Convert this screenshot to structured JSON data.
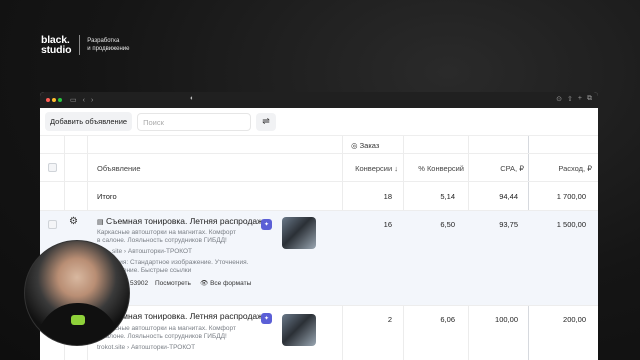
{
  "brand": {
    "logo_line1": "black.",
    "logo_line2": "studio",
    "tagline_line1": "Разработка",
    "tagline_line2": "и продвижение"
  },
  "browser": {
    "center_glyph": "◐",
    "icons": [
      "sidebar-icon",
      "back-icon",
      "forward-icon",
      "download-icon",
      "share-icon",
      "new-tab-icon",
      "tabs-icon"
    ]
  },
  "toolbar": {
    "add_label": "Добавить объявление",
    "search_placeholder": "Поиск",
    "filter_icon": "sliders-icon"
  },
  "table": {
    "goal_header": "◎ Заказ",
    "columns": {
      "ad": "Объявление",
      "conversions": "Конверсии ↓",
      "conv_pct": "% Конверсий",
      "cpa": "CPA, ₽",
      "spend": "Расход, ₽"
    },
    "total": {
      "label": "Итого",
      "conversions": "18",
      "conv_pct": "5,14",
      "cpa": "94,44",
      "spend": "1 700,00"
    },
    "rows": [
      {
        "title": "Съемная тонировка. Летняя распродажа",
        "text1": "Каркасные автошторки на магнитах. Комфорт",
        "text2": "в салоне. Лояльность сотрудников ГИБДД!",
        "site": "site › Автошторки-ТРОКОТ",
        "ext1": "ения: Стандартное изображение. Уточнения.",
        "ext2": "олнение. Быстрые ссылки",
        "id": "53902",
        "view": "Посмотреть",
        "formats": "Все форматы",
        "conversions": "16",
        "conv_pct": "6,50",
        "cpa": "93,75",
        "spend": "1 500,00"
      },
      {
        "title": "Съемная тонировка. Летняя распродажа",
        "text1": "Каркасные автошторки на магнитах. Комфорт",
        "text2": "в салоне. Лояльность сотрудников ГИБДД!",
        "site": "trokot.site › Автошторки-ТРОКОТ",
        "conversions": "2",
        "conv_pct": "6,06",
        "cpa": "100,00",
        "spend": "200,00"
      }
    ]
  },
  "colors": {
    "background": "#151515",
    "accent": "#5b5fd6",
    "row_highlight": "#f3f6fb"
  }
}
